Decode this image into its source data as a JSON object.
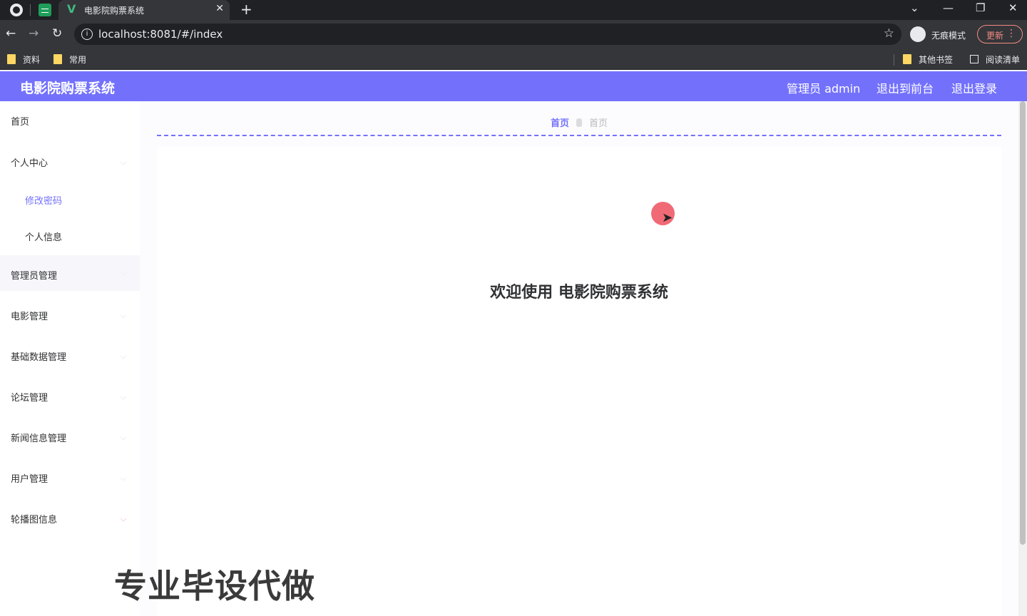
{
  "browser": {
    "tab_title": "电影院购票系统",
    "tab_close": "✕",
    "new_tab": "+",
    "window_controls": [
      "⌄",
      "—",
      "❐",
      "✕"
    ],
    "back": "←",
    "forward": "→",
    "reload": "↻",
    "url": "localhost:8081/#/index",
    "bookmark_star": "☆",
    "incognito_label": "无痕模式",
    "update_label": "更新",
    "menu_dots": "⋮",
    "bookmarks": [
      "资料",
      "常用"
    ],
    "bookmarks_right": [
      "其他书签",
      "阅读清单"
    ]
  },
  "header": {
    "title": "电影院购票系统",
    "user": "管理员 admin",
    "to_front": "退出到前台",
    "logout": "退出登录",
    "color": "#7371fc"
  },
  "sidebar": {
    "items": [
      {
        "label": "首页"
      },
      {
        "label": "个人中心"
      },
      {
        "label": "修改密码"
      },
      {
        "label": "个人信息"
      },
      {
        "label": "管理员管理"
      },
      {
        "label": "电影管理"
      },
      {
        "label": "基础数据管理"
      },
      {
        "label": "论坛管理"
      },
      {
        "label": "新闻信息管理"
      },
      {
        "label": "用户管理"
      },
      {
        "label": "轮播图信息"
      }
    ]
  },
  "breadcrumb": {
    "home": "首页",
    "current": "首页"
  },
  "main": {
    "welcome": "欢迎使用 电影院购票系统"
  },
  "watermark": "专业毕设代做"
}
